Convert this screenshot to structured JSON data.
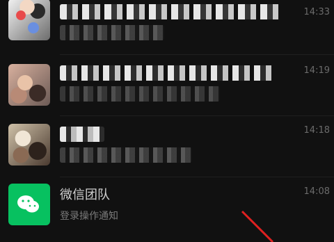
{
  "chats": [
    {
      "time": "14:33"
    },
    {
      "time": "14:19"
    },
    {
      "time": "14:18"
    },
    {
      "time": "14:08",
      "name": "微信团队",
      "preview": "登录操作通知"
    }
  ],
  "icons": {
    "wechat": "wechat-logo-icon"
  },
  "colors": {
    "background": "#111111",
    "wechat_green": "#07c160",
    "arrow": "#e02020"
  }
}
